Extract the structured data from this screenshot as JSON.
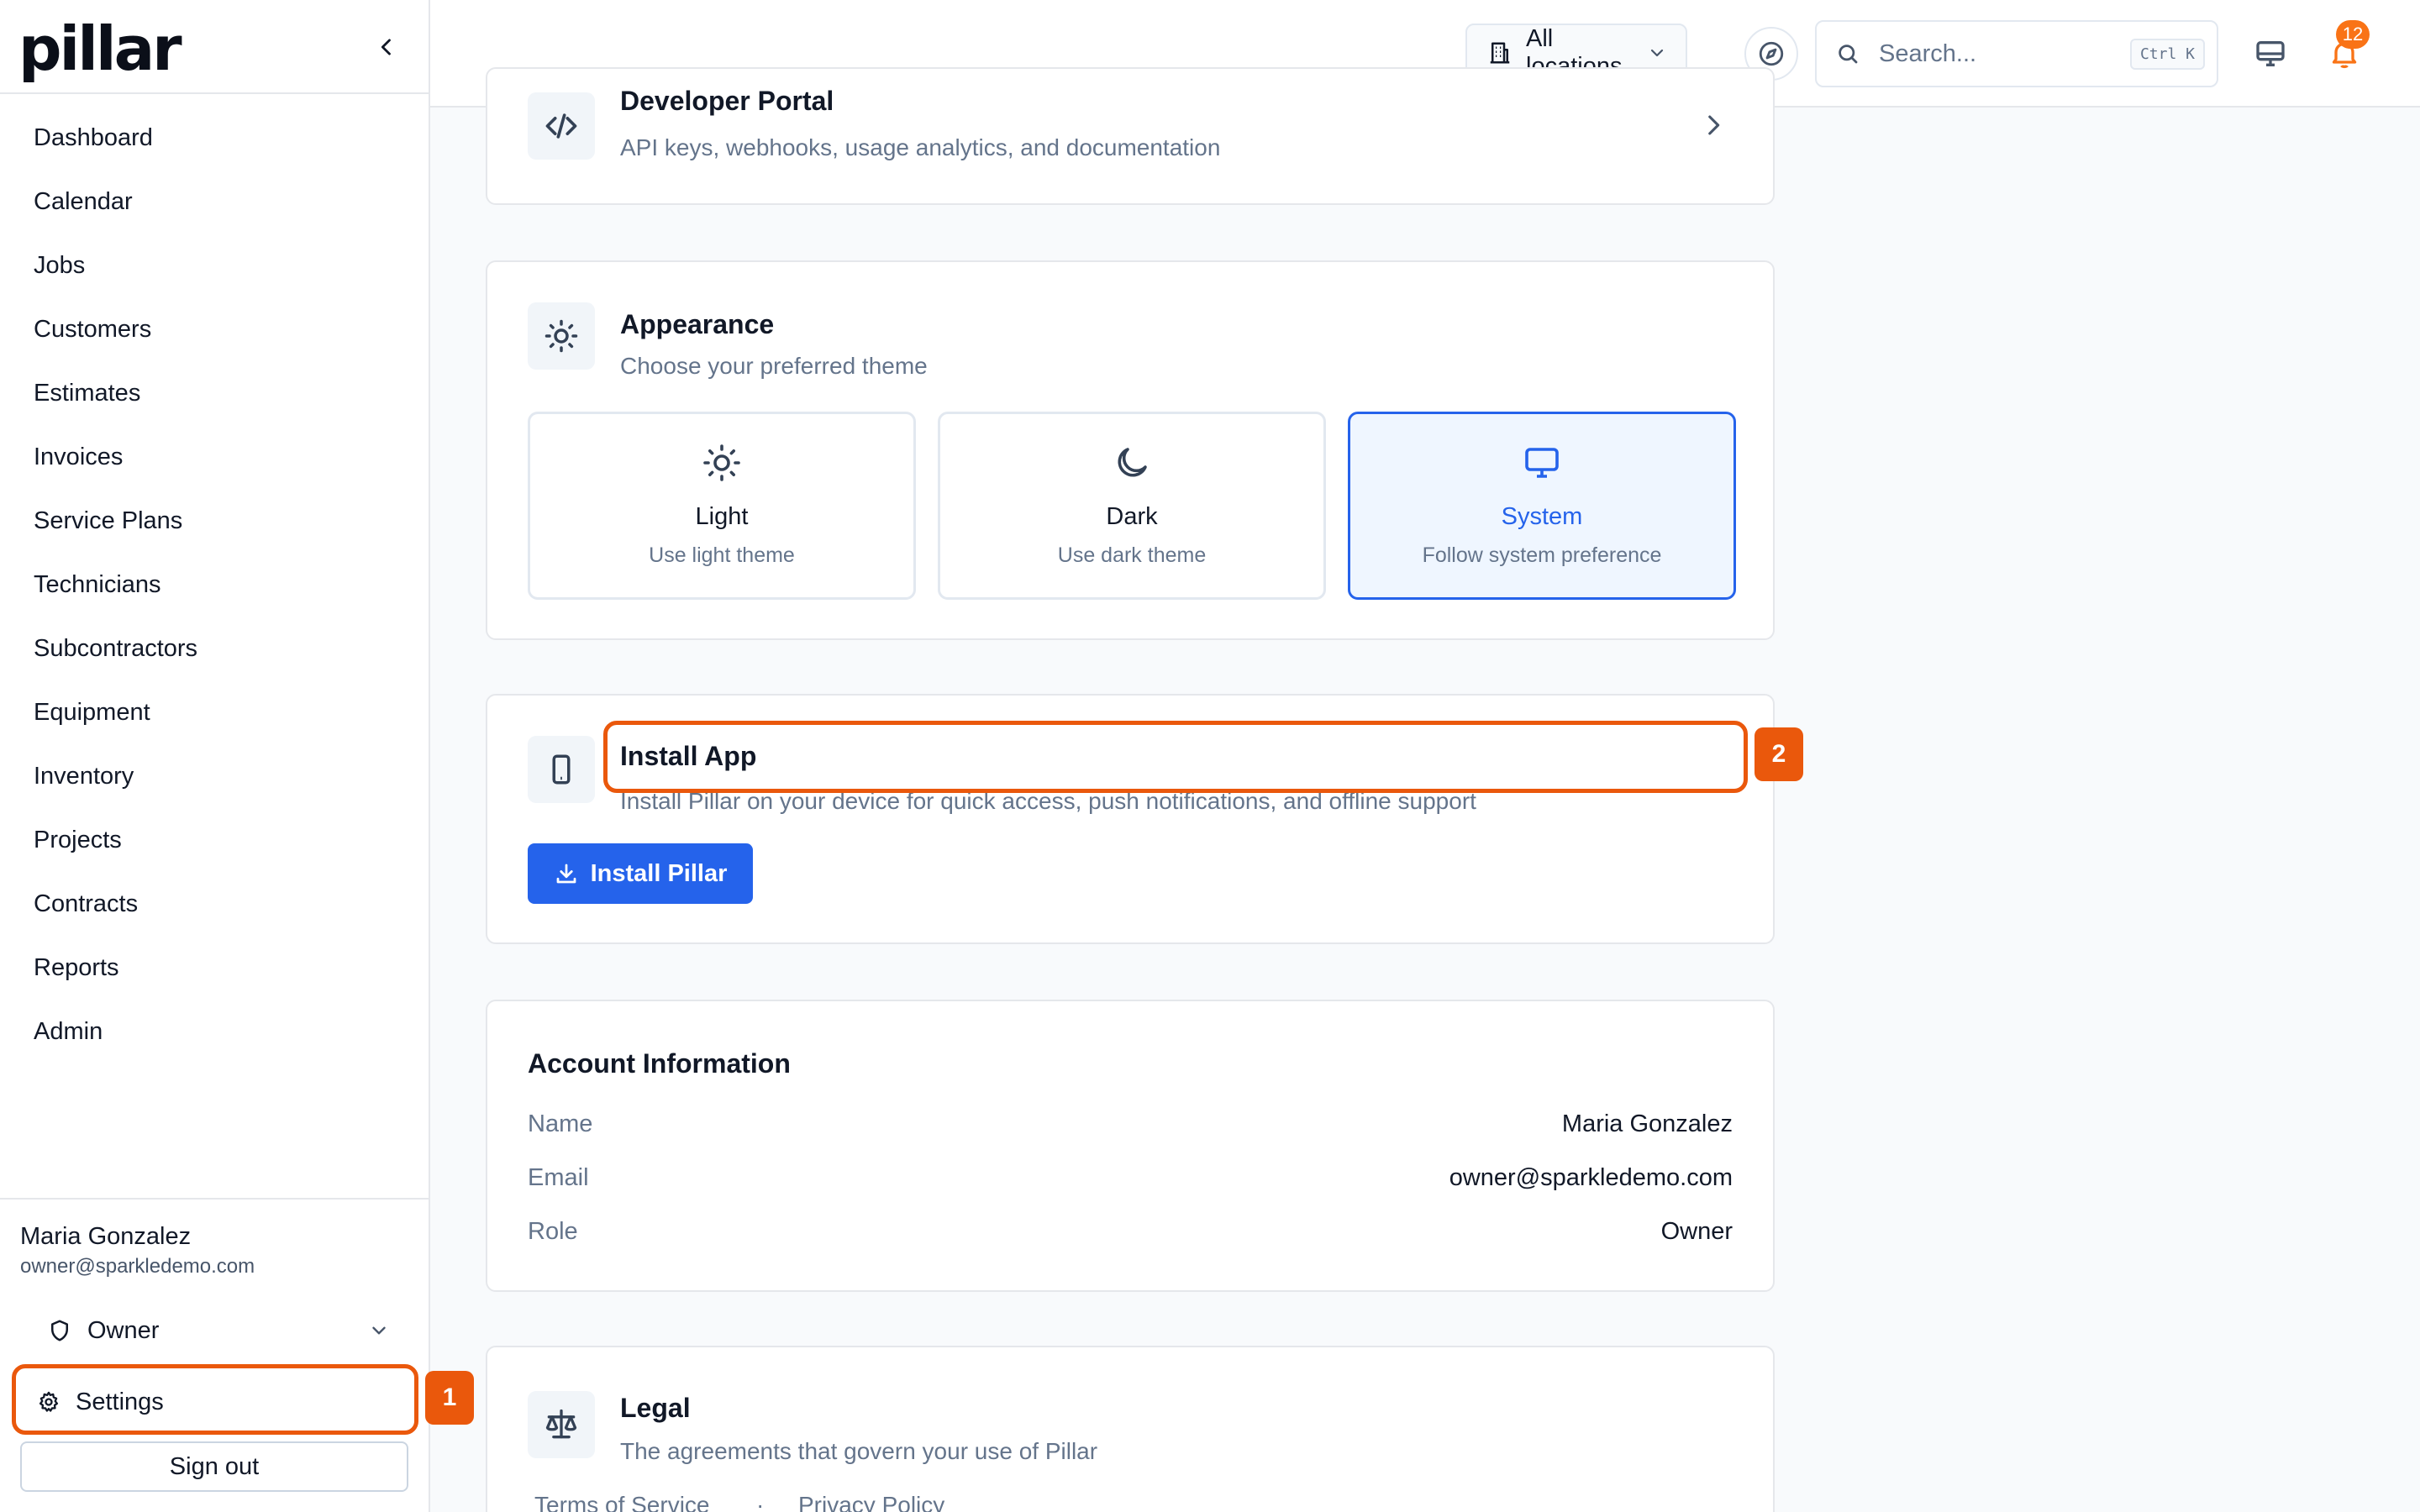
{
  "brand": {
    "logo_text": "pillar"
  },
  "nav": {
    "items": [
      {
        "label": "Dashboard"
      },
      {
        "label": "Calendar"
      },
      {
        "label": "Jobs"
      },
      {
        "label": "Customers"
      },
      {
        "label": "Estimates"
      },
      {
        "label": "Invoices"
      },
      {
        "label": "Service Plans"
      },
      {
        "label": "Technicians"
      },
      {
        "label": "Subcontractors"
      },
      {
        "label": "Equipment"
      },
      {
        "label": "Inventory"
      },
      {
        "label": "Projects"
      },
      {
        "label": "Contracts"
      },
      {
        "label": "Reports"
      },
      {
        "label": "Admin"
      }
    ]
  },
  "user": {
    "name": "Maria Gonzalez",
    "email": "owner@sparkledemo.com",
    "role": "Owner",
    "settings_label": "Settings",
    "signout_label": "Sign out"
  },
  "topbar": {
    "location_label": "All locations",
    "search_placeholder": "Search...",
    "search_shortcut": "Ctrl K",
    "notification_count": "12"
  },
  "developer_portal": {
    "title": "Developer Portal",
    "description": "API keys, webhooks, usage analytics, and documentation"
  },
  "appearance": {
    "title": "Appearance",
    "description": "Choose your preferred theme",
    "options": [
      {
        "label": "Light",
        "description": "Use light theme",
        "icon": "sun-icon"
      },
      {
        "label": "Dark",
        "description": "Use dark theme",
        "icon": "moon-icon"
      },
      {
        "label": "System",
        "description": "Follow system preference",
        "icon": "monitor-icon",
        "selected": true
      }
    ]
  },
  "install_app": {
    "title": "Install App",
    "description": "Install Pillar on your device for quick access, push notifications, and offline support",
    "button_label": "Install Pillar"
  },
  "account": {
    "title": "Account Information",
    "rows": [
      {
        "key": "Name",
        "value": "Maria Gonzalez"
      },
      {
        "key": "Email",
        "value": "owner@sparkledemo.com"
      },
      {
        "key": "Role",
        "value": "Owner"
      }
    ]
  },
  "legal": {
    "title": "Legal",
    "description": "The agreements that govern your use of Pillar",
    "links": [
      {
        "label": "Terms of Service"
      },
      {
        "label": "Privacy Policy"
      }
    ],
    "separator": "·"
  },
  "annotations": [
    {
      "label": "1"
    },
    {
      "label": "2"
    }
  ],
  "colors": {
    "accent": "#2563eb",
    "annotation": "#ea580c",
    "notification_badge": "#f97316"
  }
}
